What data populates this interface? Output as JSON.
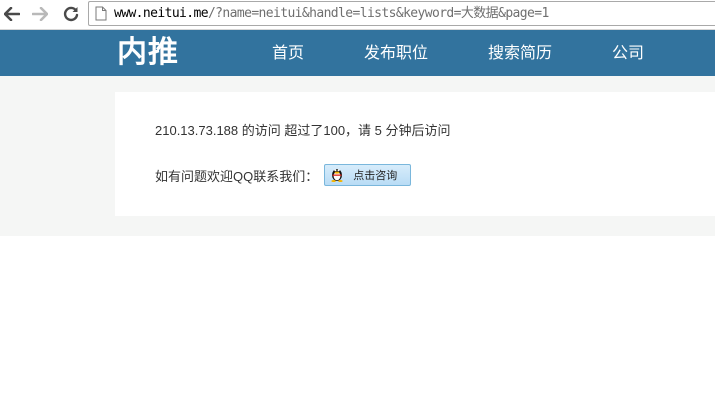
{
  "browser": {
    "url_host": "www.neitui.me",
    "url_rest": "/?name=neitui&handle=lists&keyword=大数据&page=1"
  },
  "site": {
    "logo": "内推",
    "nav": [
      "首页",
      "发布职位",
      "搜索简历",
      "公司"
    ]
  },
  "notice": {
    "message": "210.13.73.188 的访问 超过了100，请 5 分钟后访问",
    "contact_text": "如有问题欢迎QQ联系我们：",
    "qq_button_label": "点击咨询"
  },
  "colors": {
    "header": "#32739e",
    "page_bg": "#f5f6f5"
  }
}
